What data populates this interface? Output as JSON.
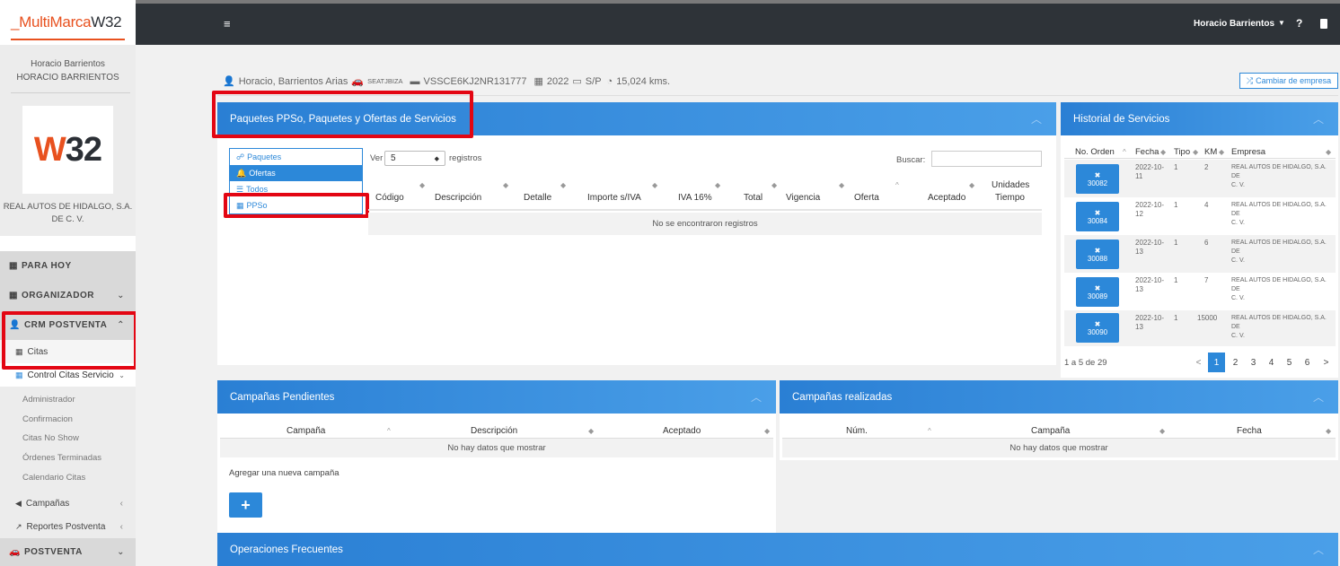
{
  "brand": {
    "prefix": "_MultiMarca",
    "suffix": "W32"
  },
  "topbar": {
    "user": "Horacio Barrientos",
    "help": "?"
  },
  "sidebar": {
    "user_name": "Horacio Barrientos",
    "user_upper": "HORACIO BARRIENTOS",
    "logo_w": "W",
    "logo_num": "32",
    "company_line1": "REAL AUTOS DE HIDALGO, S.A.",
    "company_line2": "DE C. V.",
    "sections": {
      "today": "PARA HOY",
      "organizer": "ORGANIZADOR",
      "crm": "CRM POSTVENTA",
      "postventa": "POSTVENTA"
    },
    "crm_items": {
      "citas": "Citas",
      "control": "Control Citas Servicio",
      "campanas": "Campañas",
      "reportes": "Reportes Postventa"
    },
    "sub_items": [
      "Administrador",
      "Confirmacion",
      "Citas No Show",
      "Órdenes Terminadas",
      "Calendario Citas"
    ]
  },
  "vehicle": {
    "owner": "Horacio, Barrientos Arias",
    "brand": "SEATJBIZA",
    "vin": "VSSCE6KJ2NR131777",
    "year": "2022",
    "plate": "S/P",
    "km": "15,024 kms."
  },
  "change_company": "Cambiar de empresa",
  "paquetes": {
    "title": "Paquetes PPSo, Paquetes y Ofertas de Servicios",
    "tabs": [
      "Paquetes",
      "Ofertas",
      "Todos",
      "PPSo"
    ],
    "show_label": "Ver",
    "show_value": "5",
    "records_label": "registros",
    "search_label": "Buscar:",
    "columns": [
      "Código",
      "Descripción",
      "Detalle",
      "Importe s/IVA",
      "IVA 16%",
      "Total",
      "Vigencia",
      "Oferta",
      "Aceptado",
      "Unidades",
      "Tiempo"
    ],
    "empty": "No se encontraron registros"
  },
  "historial": {
    "title": "Historial de Servicios",
    "columns": [
      "No. Orden",
      "Fecha",
      "Tipo",
      "KM",
      "Empresa"
    ],
    "rows": [
      {
        "order": "30082",
        "date1": "2022-10-",
        "date2": "11",
        "type": "1",
        "km": "2",
        "company1": "REAL AUTOS DE HIDALGO, S.A. DE",
        "company2": "C. V."
      },
      {
        "order": "30084",
        "date1": "2022-10-",
        "date2": "12",
        "type": "1",
        "km": "4",
        "company1": "REAL AUTOS DE HIDALGO, S.A. DE",
        "company2": "C. V."
      },
      {
        "order": "30088",
        "date1": "2022-10-",
        "date2": "13",
        "type": "1",
        "km": "6",
        "company1": "REAL AUTOS DE HIDALGO, S.A. DE",
        "company2": "C. V."
      },
      {
        "order": "30089",
        "date1": "2022-10-",
        "date2": "13",
        "type": "1",
        "km": "7",
        "company1": "REAL AUTOS DE HIDALGO, S.A. DE",
        "company2": "C. V."
      },
      {
        "order": "30090",
        "date1": "2022-10-",
        "date2": "13",
        "type": "1",
        "km": "15000",
        "company1": "REAL AUTOS DE HIDALGO, S.A. DE",
        "company2": "C. V."
      }
    ],
    "info": "1 a 5 de 29",
    "pages": [
      "<",
      "1",
      "2",
      "3",
      "4",
      "5",
      "6",
      ">"
    ]
  },
  "campanas_pend": {
    "title": "Campañas Pendientes",
    "columns": [
      "Campaña",
      "Descripción",
      "Aceptado"
    ],
    "empty": "No hay datos que mostrar",
    "add_label": "Agregar una nueva campaña",
    "add_btn": "+"
  },
  "campanas_real": {
    "title": "Campañas realizadas",
    "columns": [
      "Núm.",
      "Campaña",
      "Fecha"
    ],
    "empty": "No hay datos que mostrar"
  },
  "operaciones": {
    "title": "Operaciones Frecuentes"
  }
}
